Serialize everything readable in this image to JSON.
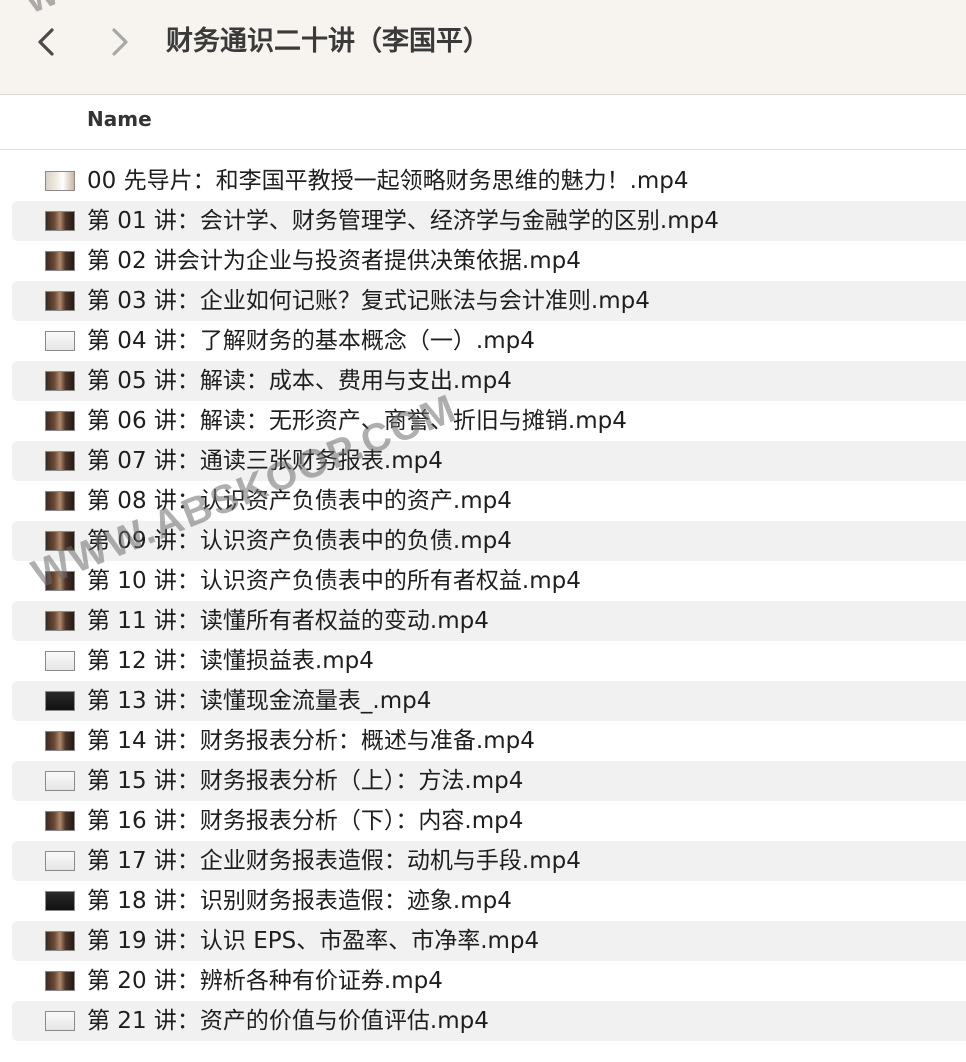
{
  "toolbar": {
    "title": "财务通识二十讲（李国平）",
    "back_icon": "chevron-left-icon",
    "forward_icon": "chevron-right-icon"
  },
  "columns": {
    "name": "Name"
  },
  "files": [
    {
      "name": "00 先导片：和李国平教授一起领略财务思维的魅力！.mp4",
      "thumb": "intro"
    },
    {
      "name": "第 01 讲：会计学、财务管理学、经济学与金融学的区别.mp4",
      "thumb": "scene"
    },
    {
      "name": "第 02 讲会计为企业与投资者提供决策依据.mp4",
      "thumb": "scene"
    },
    {
      "name": "第 03 讲：企业如何记账？复式记账法与会计准则.mp4",
      "thumb": "scene"
    },
    {
      "name": "第 04 讲：了解财务的基本概念（一）.mp4",
      "thumb": "white"
    },
    {
      "name": "第 05 讲：解读：成本、费用与支出.mp4",
      "thumb": "scene"
    },
    {
      "name": "第 06 讲：解读：无形资产、商誉、折旧与摊销.mp4",
      "thumb": "scene"
    },
    {
      "name": "第 07 讲：通读三张财务报表.mp4",
      "thumb": "scene"
    },
    {
      "name": "第 08 讲：认识资产负债表中的资产.mp4",
      "thumb": "scene"
    },
    {
      "name": "第 09 讲：认识资产负债表中的负债.mp4",
      "thumb": "scene"
    },
    {
      "name": "第 10 讲：认识资产负债表中的所有者权益.mp4",
      "thumb": "scene"
    },
    {
      "name": "第 11 讲：读懂所有者权益的变动.mp4",
      "thumb": "scene"
    },
    {
      "name": "第 12 讲：读懂损益表.mp4",
      "thumb": "white"
    },
    {
      "name": "第 13 讲：读懂现金流量表_.mp4",
      "thumb": "black"
    },
    {
      "name": "第 14 讲：财务报表分析：概述与准备.mp4",
      "thumb": "scene"
    },
    {
      "name": "第 15 讲：财务报表分析（上）：方法.mp4",
      "thumb": "white"
    },
    {
      "name": "第 16 讲：财务报表分析（下）：内容.mp4",
      "thumb": "scene"
    },
    {
      "name": "第 17 讲：企业财务报表造假：动机与手段.mp4",
      "thumb": "white"
    },
    {
      "name": "第 18 讲：识别财务报表造假：迹象.mp4",
      "thumb": "black"
    },
    {
      "name": "第 19 讲：认识 EPS、市盈率、市净率.mp4",
      "thumb": "scene"
    },
    {
      "name": "第 20 讲：辨析各种有价证券.mp4",
      "thumb": "scene"
    },
    {
      "name": "第 21 讲：资产的价值与价值评估.mp4",
      "thumb": "white"
    }
  ],
  "watermark": {
    "top": "WW",
    "middle": "WWW.ABSKOOP.COM"
  }
}
